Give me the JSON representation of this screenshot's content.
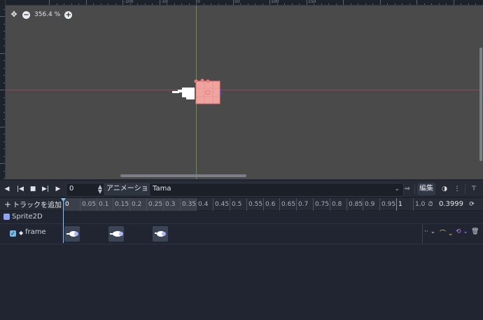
{
  "viewport": {
    "zoom": "356.4 %",
    "ruler_labels": [
      "-100",
      "-50",
      "0",
      "50",
      "100",
      "150"
    ],
    "zoom_out_icon": "minus-circle-icon",
    "zoom_in_icon": "plus-circle-icon",
    "pan_icon": "move-icon"
  },
  "toolbar": {
    "frame_value": "0",
    "animation_label": "アニメーション",
    "animation_name": "Tama",
    "edit_label": "編集"
  },
  "timeline": {
    "add_track_label": "トラックを追加",
    "ticks": [
      "0",
      "0.05",
      "0.1",
      "0.15",
      "0.2",
      "0.25",
      "0.3",
      "0.35",
      "0.4",
      "0.45",
      "0.5",
      "0.55",
      "0.6",
      "0.65",
      "0.7",
      "0.75",
      "0.8",
      "0.85",
      "0.9",
      "0.95",
      "1",
      "1.0"
    ],
    "length_value": "0.3999"
  },
  "tracks": {
    "node_name": "Sprite2D",
    "track_name": "frame",
    "keyframe_count": 3
  },
  "colors": {
    "accent": "#7fc7ff",
    "axis_x": "#8e4a62",
    "axis_y": "#6b8a4e"
  }
}
